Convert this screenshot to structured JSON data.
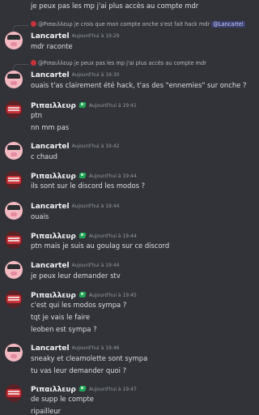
{
  "colors": {
    "background": "#313338",
    "username": "#f2f3f5",
    "timestamp": "#949ba4",
    "message_text": "#dbdee1",
    "mention_bg": "#3c4270",
    "badge_green": "#23a559"
  },
  "top_line": "je peux pas les mp j'ai plus accès au compte mdr",
  "users": {
    "lancartel": "Lancartel",
    "ripailleur": "Ριπαιλλευρ",
    "ripailleur_mention": "@Ριπαιλλευρ"
  },
  "messages": [
    {
      "reply": "je crois que mon compte onche s'est fait hack mdr",
      "reply_mention": "@Lancartel",
      "author": "Lancartel",
      "time": "Aujourd'hui à 19:29",
      "lines": [
        "mdr raconte"
      ]
    },
    {
      "reply": "je peux pas les mp j'ai plus accès au compte mdr",
      "author": "Lancartel",
      "time": "Aujourd'hui à 19:30",
      "lines": [
        "ouais t'as clairement été hack, t'as des \"ennemies\" sur onche ?"
      ]
    },
    {
      "author": "Ριπαιλλευρ",
      "time": "Aujourd'hui à 19:41",
      "lines": [
        "ptn",
        "nn mm pas"
      ]
    },
    {
      "author": "Lancartel",
      "time": "Aujourd'hui à 19:42",
      "lines": [
        "c chaud"
      ]
    },
    {
      "author": "Ριπαιλλευρ",
      "time": "Aujourd'hui à 19:44",
      "lines": [
        "ils sont sur le discord les modos ?"
      ]
    },
    {
      "author": "Lancartel",
      "time": "Aujourd'hui à 19:44",
      "lines": [
        "ouais"
      ]
    },
    {
      "author": "Ριπαιλλευρ",
      "time": "Aujourd'hui à 19:44",
      "lines": [
        "ptn mais je suis au goulag sur ce discord"
      ]
    },
    {
      "author": "Lancartel",
      "time": "Aujourd'hui à 19:44",
      "lines": [
        "je peux leur demander stv"
      ]
    },
    {
      "author": "Ριπαιλλευρ",
      "time": "Aujourd'hui à 19:45",
      "lines": [
        "c'est qui les modos sympa ?",
        "tqt je vais le faire",
        "leoben est sympa ?"
      ]
    },
    {
      "author": "Lancartel",
      "time": "Aujourd'hui à 19:46",
      "lines": [
        "sneaky et cleamolette sont sympa",
        "tu vas leur demander quoi ?"
      ]
    },
    {
      "author": "Ριπαιλλευρ",
      "time": "Aujourd'hui à 19:47",
      "lines": [
        "de supp le compte",
        "ripailleur"
      ]
    }
  ]
}
